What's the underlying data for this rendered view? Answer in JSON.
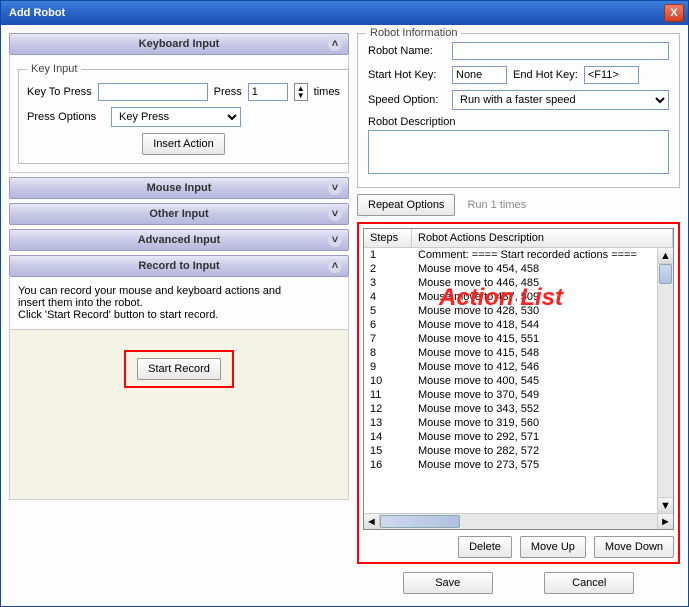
{
  "window": {
    "title": "Add Robot"
  },
  "accordion": {
    "keyboard": {
      "label": "Keyboard Input"
    },
    "mouse": {
      "label": "Mouse Input"
    },
    "other": {
      "label": "Other Input"
    },
    "advanced": {
      "label": "Advanced Input"
    },
    "record": {
      "label": "Record to Input"
    }
  },
  "key_input": {
    "legend": "Key Input",
    "key_to_press_label": "Key To Press",
    "key_to_press_value": "",
    "press_label": "Press",
    "press_count": "1",
    "times_label": "times",
    "press_options_label": "Press Options",
    "press_options_value": "Key Press",
    "insert_action": "Insert Action"
  },
  "record": {
    "instructions_line1": "You can record your mouse and keyboard actions and",
    "instructions_line2": "insert them into the robot.",
    "instructions_line3": "Click 'Start Record' button to start record.",
    "start_button": "Start Record"
  },
  "robot_info": {
    "legend": "Robot Information",
    "name_label": "Robot Name:",
    "name_value": "",
    "start_hotkey_label": "Start Hot Key:",
    "start_hotkey_value": "None",
    "end_hotkey_label": "End Hot Key:",
    "end_hotkey_value": "<F11>",
    "speed_label": "Speed Option:",
    "speed_value": "Run with a faster speed",
    "desc_label": "Robot Description",
    "desc_value": ""
  },
  "repeat": {
    "button": "Repeat Options",
    "text": "Run 1 times"
  },
  "action_list": {
    "annotation": "Action List",
    "col_steps": "Steps",
    "col_desc": "Robot Actions Description",
    "rows": [
      {
        "step": "1",
        "desc": "Comment: ==== Start recorded actions ===="
      },
      {
        "step": "2",
        "desc": "Mouse move to 454, 458"
      },
      {
        "step": "3",
        "desc": "Mouse move to 446, 485"
      },
      {
        "step": "4",
        "desc": "Mouse move to 437, 509"
      },
      {
        "step": "5",
        "desc": "Mouse move to 428, 530"
      },
      {
        "step": "6",
        "desc": "Mouse move to 418, 544"
      },
      {
        "step": "7",
        "desc": "Mouse move to 415, 551"
      },
      {
        "step": "8",
        "desc": "Mouse move to 415, 548"
      },
      {
        "step": "9",
        "desc": "Mouse move to 412, 546"
      },
      {
        "step": "10",
        "desc": "Mouse move to 400, 545"
      },
      {
        "step": "11",
        "desc": "Mouse move to 370, 549"
      },
      {
        "step": "12",
        "desc": "Mouse move to 343, 552"
      },
      {
        "step": "13",
        "desc": "Mouse move to 319, 560"
      },
      {
        "step": "14",
        "desc": "Mouse move to 292, 571"
      },
      {
        "step": "15",
        "desc": "Mouse move to 282, 572"
      },
      {
        "step": "16",
        "desc": "Mouse move to 273, 575"
      }
    ],
    "delete": "Delete",
    "move_up": "Move Up",
    "move_down": "Move Down"
  },
  "bottom": {
    "save": "Save",
    "cancel": "Cancel"
  },
  "icons": {
    "close": "X",
    "chev_up": "˄",
    "chev_down": "˅",
    "tri_l": "◄",
    "tri_r": "►",
    "tri_u": "▲",
    "tri_d": "▼"
  }
}
